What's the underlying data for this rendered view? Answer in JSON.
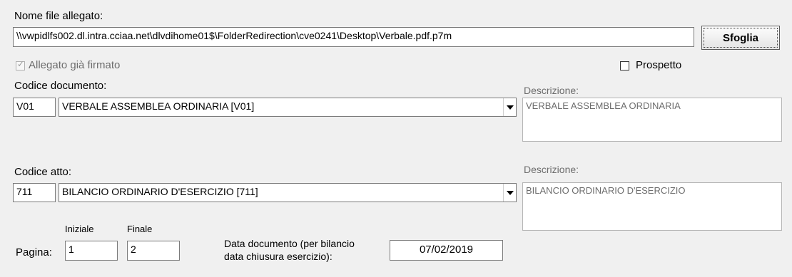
{
  "attachment": {
    "label": "Nome file allegato:",
    "path": "\\\\vwpidlfs002.dl.intra.cciaa.net\\dlvdihome01$\\FolderRedirection\\cve0241\\Desktop\\Verbale.pdf.p7m",
    "browse_label": "Sfoglia"
  },
  "signed_checkbox": {
    "label": "Allegato già firmato",
    "checked": true
  },
  "prospetto_checkbox": {
    "label": "Prospetto",
    "checked": false
  },
  "document": {
    "label": "Codice documento:",
    "code": "V01",
    "selected": "VERBALE ASSEMBLEA ORDINARIA [V01]",
    "description_label": "Descrizione:",
    "description": "VERBALE ASSEMBLEA ORDINARIA"
  },
  "act": {
    "label": "Codice atto:",
    "code": "711",
    "selected": "BILANCIO ORDINARIO D'ESERCIZIO [711]",
    "description_label": "Descrizione:",
    "description": "BILANCIO ORDINARIO D'ESERCIZIO"
  },
  "pages": {
    "label": "Pagina:",
    "start_label": "Iniziale",
    "start": "1",
    "end_label": "Finale",
    "end": "2"
  },
  "doc_date": {
    "label": "Data documento (per bilancio data chiusura esercizio):",
    "value": "07/02/2019"
  }
}
